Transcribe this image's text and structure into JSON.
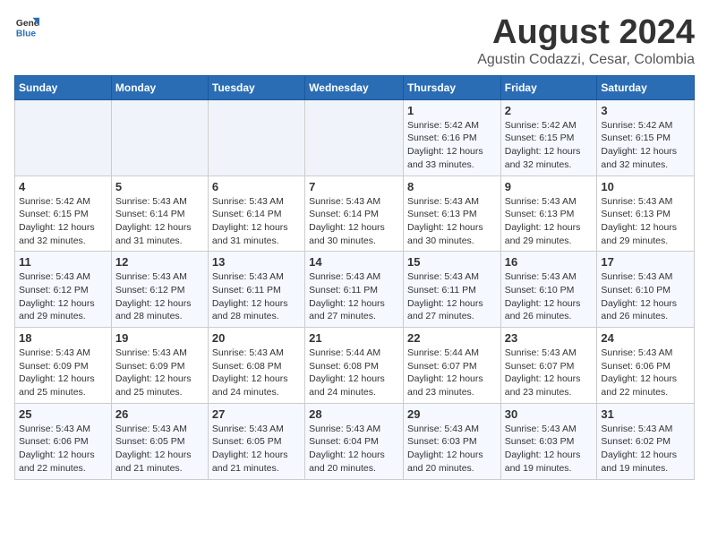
{
  "header": {
    "logo_general": "General",
    "logo_blue": "Blue",
    "main_title": "August 2024",
    "subtitle": "Agustin Codazzi, Cesar, Colombia"
  },
  "calendar": {
    "days_of_week": [
      "Sunday",
      "Monday",
      "Tuesday",
      "Wednesday",
      "Thursday",
      "Friday",
      "Saturday"
    ],
    "weeks": [
      [
        {
          "day": "",
          "info": ""
        },
        {
          "day": "",
          "info": ""
        },
        {
          "day": "",
          "info": ""
        },
        {
          "day": "",
          "info": ""
        },
        {
          "day": "1",
          "info": "Sunrise: 5:42 AM\nSunset: 6:16 PM\nDaylight: 12 hours\nand 33 minutes."
        },
        {
          "day": "2",
          "info": "Sunrise: 5:42 AM\nSunset: 6:15 PM\nDaylight: 12 hours\nand 32 minutes."
        },
        {
          "day": "3",
          "info": "Sunrise: 5:42 AM\nSunset: 6:15 PM\nDaylight: 12 hours\nand 32 minutes."
        }
      ],
      [
        {
          "day": "4",
          "info": "Sunrise: 5:42 AM\nSunset: 6:15 PM\nDaylight: 12 hours\nand 32 minutes."
        },
        {
          "day": "5",
          "info": "Sunrise: 5:43 AM\nSunset: 6:14 PM\nDaylight: 12 hours\nand 31 minutes."
        },
        {
          "day": "6",
          "info": "Sunrise: 5:43 AM\nSunset: 6:14 PM\nDaylight: 12 hours\nand 31 minutes."
        },
        {
          "day": "7",
          "info": "Sunrise: 5:43 AM\nSunset: 6:14 PM\nDaylight: 12 hours\nand 30 minutes."
        },
        {
          "day": "8",
          "info": "Sunrise: 5:43 AM\nSunset: 6:13 PM\nDaylight: 12 hours\nand 30 minutes."
        },
        {
          "day": "9",
          "info": "Sunrise: 5:43 AM\nSunset: 6:13 PM\nDaylight: 12 hours\nand 29 minutes."
        },
        {
          "day": "10",
          "info": "Sunrise: 5:43 AM\nSunset: 6:13 PM\nDaylight: 12 hours\nand 29 minutes."
        }
      ],
      [
        {
          "day": "11",
          "info": "Sunrise: 5:43 AM\nSunset: 6:12 PM\nDaylight: 12 hours\nand 29 minutes."
        },
        {
          "day": "12",
          "info": "Sunrise: 5:43 AM\nSunset: 6:12 PM\nDaylight: 12 hours\nand 28 minutes."
        },
        {
          "day": "13",
          "info": "Sunrise: 5:43 AM\nSunset: 6:11 PM\nDaylight: 12 hours\nand 28 minutes."
        },
        {
          "day": "14",
          "info": "Sunrise: 5:43 AM\nSunset: 6:11 PM\nDaylight: 12 hours\nand 27 minutes."
        },
        {
          "day": "15",
          "info": "Sunrise: 5:43 AM\nSunset: 6:11 PM\nDaylight: 12 hours\nand 27 minutes."
        },
        {
          "day": "16",
          "info": "Sunrise: 5:43 AM\nSunset: 6:10 PM\nDaylight: 12 hours\nand 26 minutes."
        },
        {
          "day": "17",
          "info": "Sunrise: 5:43 AM\nSunset: 6:10 PM\nDaylight: 12 hours\nand 26 minutes."
        }
      ],
      [
        {
          "day": "18",
          "info": "Sunrise: 5:43 AM\nSunset: 6:09 PM\nDaylight: 12 hours\nand 25 minutes."
        },
        {
          "day": "19",
          "info": "Sunrise: 5:43 AM\nSunset: 6:09 PM\nDaylight: 12 hours\nand 25 minutes."
        },
        {
          "day": "20",
          "info": "Sunrise: 5:43 AM\nSunset: 6:08 PM\nDaylight: 12 hours\nand 24 minutes."
        },
        {
          "day": "21",
          "info": "Sunrise: 5:44 AM\nSunset: 6:08 PM\nDaylight: 12 hours\nand 24 minutes."
        },
        {
          "day": "22",
          "info": "Sunrise: 5:44 AM\nSunset: 6:07 PM\nDaylight: 12 hours\nand 23 minutes."
        },
        {
          "day": "23",
          "info": "Sunrise: 5:43 AM\nSunset: 6:07 PM\nDaylight: 12 hours\nand 23 minutes."
        },
        {
          "day": "24",
          "info": "Sunrise: 5:43 AM\nSunset: 6:06 PM\nDaylight: 12 hours\nand 22 minutes."
        }
      ],
      [
        {
          "day": "25",
          "info": "Sunrise: 5:43 AM\nSunset: 6:06 PM\nDaylight: 12 hours\nand 22 minutes."
        },
        {
          "day": "26",
          "info": "Sunrise: 5:43 AM\nSunset: 6:05 PM\nDaylight: 12 hours\nand 21 minutes."
        },
        {
          "day": "27",
          "info": "Sunrise: 5:43 AM\nSunset: 6:05 PM\nDaylight: 12 hours\nand 21 minutes."
        },
        {
          "day": "28",
          "info": "Sunrise: 5:43 AM\nSunset: 6:04 PM\nDaylight: 12 hours\nand 20 minutes."
        },
        {
          "day": "29",
          "info": "Sunrise: 5:43 AM\nSunset: 6:03 PM\nDaylight: 12 hours\nand 20 minutes."
        },
        {
          "day": "30",
          "info": "Sunrise: 5:43 AM\nSunset: 6:03 PM\nDaylight: 12 hours\nand 19 minutes."
        },
        {
          "day": "31",
          "info": "Sunrise: 5:43 AM\nSunset: 6:02 PM\nDaylight: 12 hours\nand 19 minutes."
        }
      ]
    ]
  }
}
